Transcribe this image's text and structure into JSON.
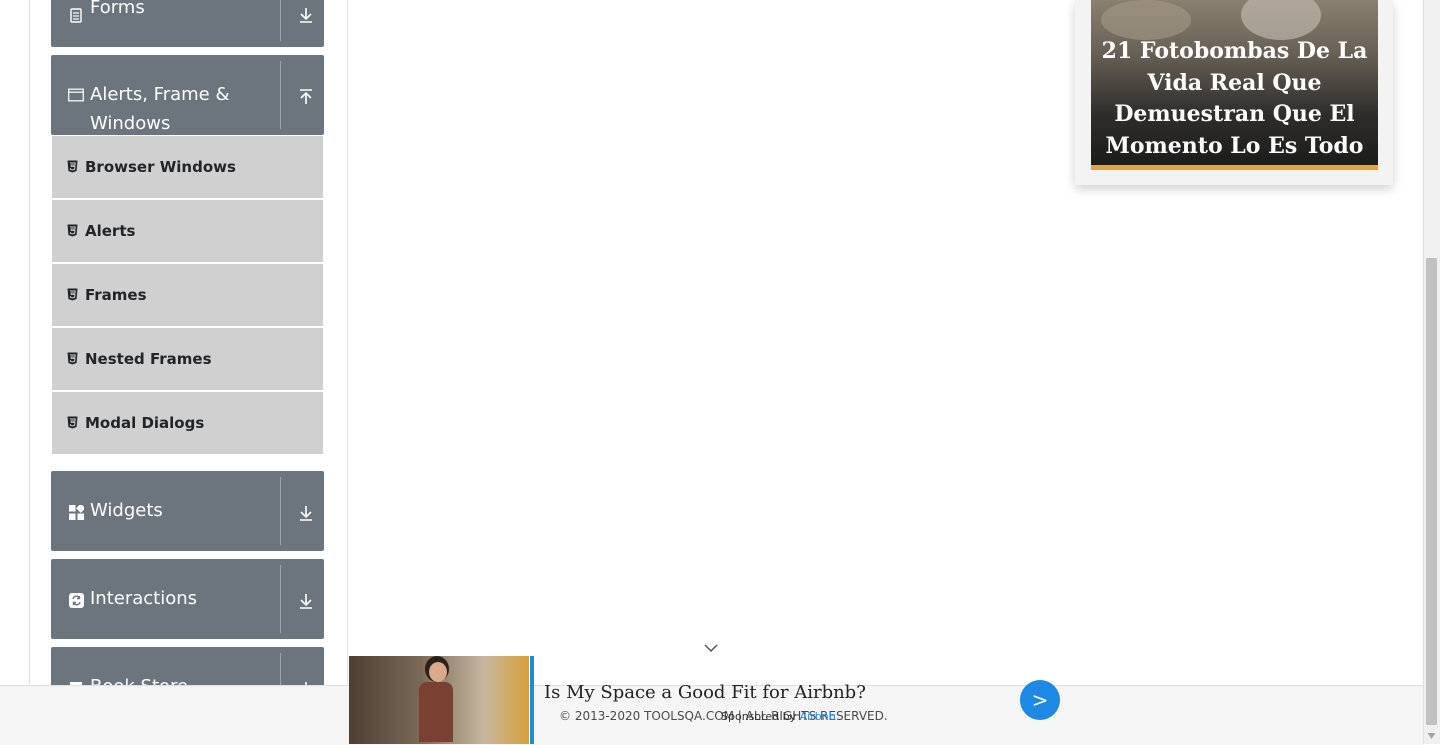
{
  "sidebar": {
    "forms": {
      "label": "Forms",
      "icon": "form-icon",
      "toggle_icon": "arrow-down-icon"
    },
    "alerts": {
      "label": "Alerts, Frame & Windows",
      "icon": "window-icon",
      "toggle_icon": "arrow-up-icon"
    },
    "alerts_items": [
      {
        "label": "Browser Windows",
        "icon": "html5-icon"
      },
      {
        "label": "Alerts",
        "icon": "html5-icon"
      },
      {
        "label": "Frames",
        "icon": "html5-icon"
      },
      {
        "label": "Nested Frames",
        "icon": "html5-icon"
      },
      {
        "label": "Modal Dialogs",
        "icon": "html5-icon"
      }
    ],
    "widgets": {
      "label": "Widgets",
      "icon": "widgets-icon",
      "toggle_icon": "arrow-down-icon"
    },
    "interactions": {
      "label": "Interactions",
      "icon": "interactions-icon",
      "toggle_icon": "arrow-down-icon"
    },
    "book_store": {
      "label": "Book Store",
      "icon": "book-icon",
      "toggle_icon": "arrow-down-icon"
    }
  },
  "side_ad": {
    "headline": "21 Fotobombas De La Vida Real Que Demuestran Que El Momento Lo Es Todo"
  },
  "footer": {
    "copyright": "© 2013-2020 TOOLSQA.COM | ALL RIGHTS RESERVED."
  },
  "bottom_ad": {
    "headline": "Is My Space a Good Fit for Airbnb?",
    "sponsor_prefix": "Sponsored by",
    "sponsor_name": "Airbnb",
    "cta": ">"
  },
  "colors": {
    "group_header": "#6c757d",
    "sub_item_bg": "#d0d0d0",
    "accent_blue": "#1e88e5",
    "ad_underline": "#e8a23b"
  }
}
